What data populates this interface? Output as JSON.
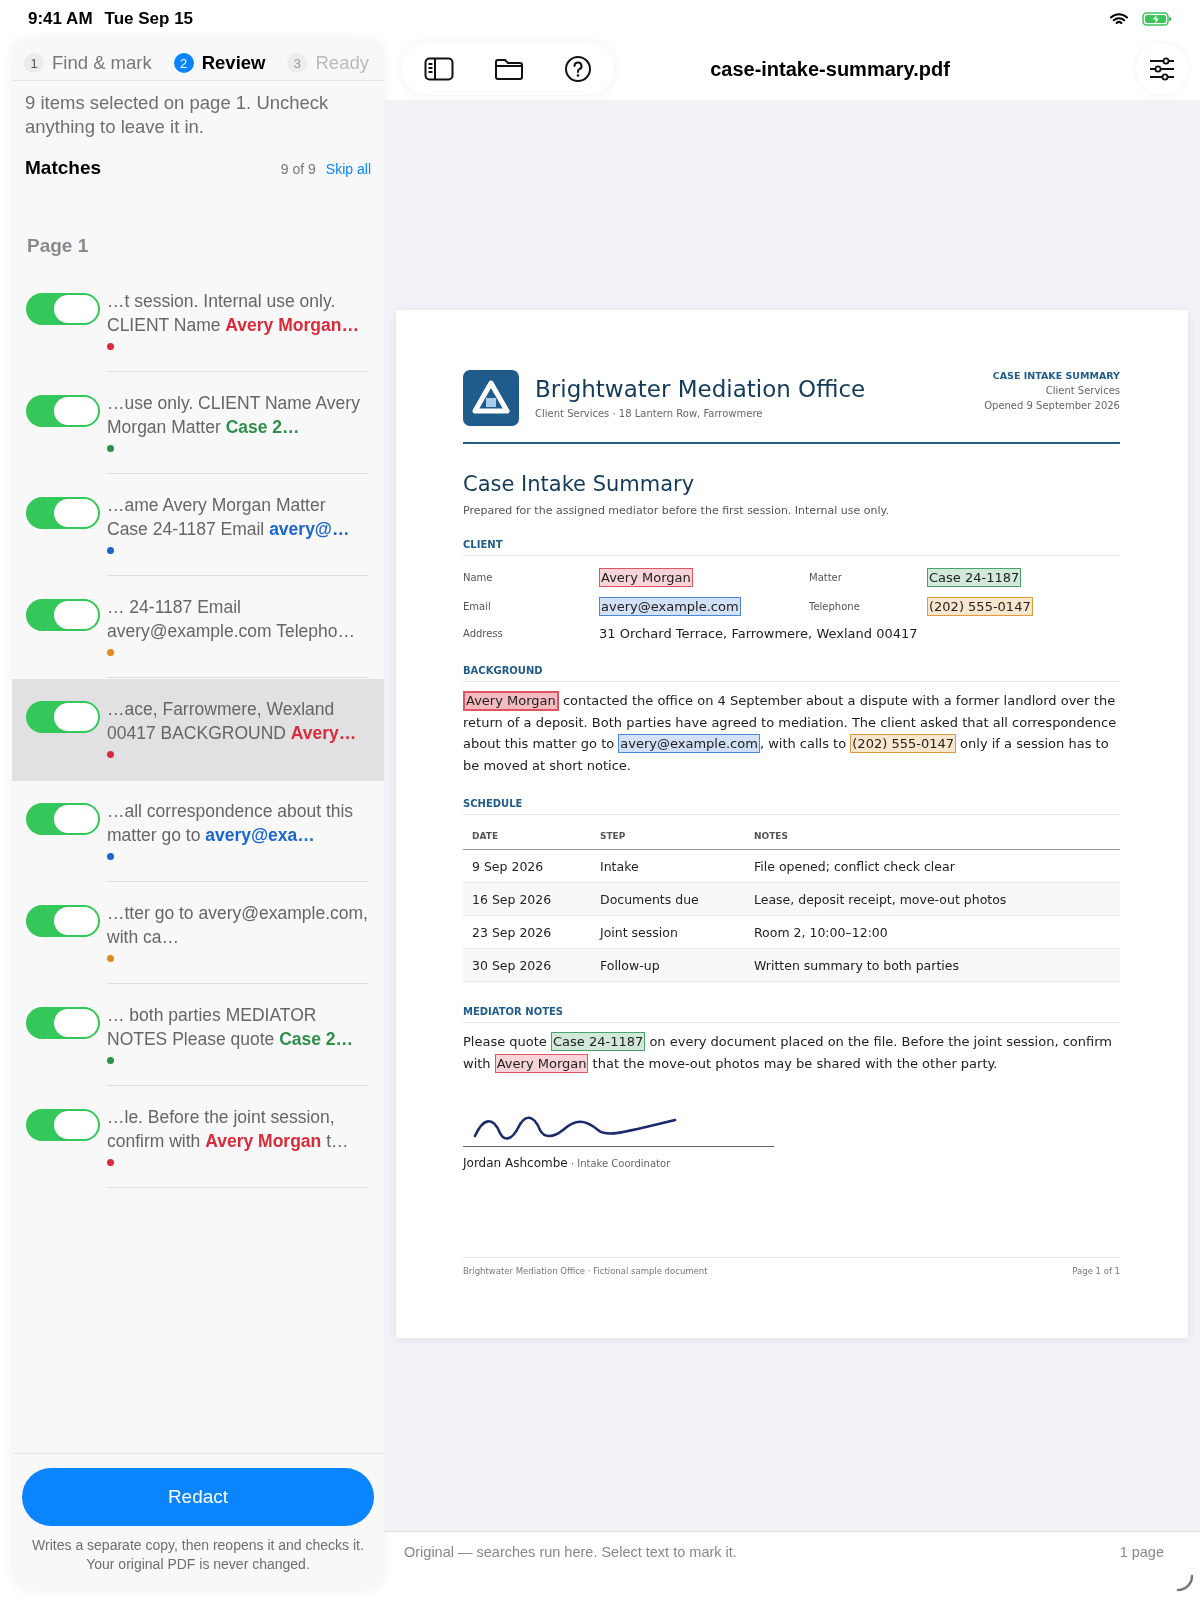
{
  "status_bar": {
    "time": "9:41 AM",
    "date": "Tue Sep 15"
  },
  "steps": [
    {
      "number": "1",
      "label": "Find & mark",
      "selected": false,
      "done": true
    },
    {
      "number": "2",
      "label": "Review",
      "selected": true,
      "done": false
    },
    {
      "number": "3",
      "label": "Ready",
      "selected": false,
      "done": false
    }
  ],
  "intro": "9 items selected on page 1. Uncheck anything to leave it in.",
  "matches": {
    "title": "Matches",
    "count": "9 of 9",
    "skip_link": "Skip all",
    "page_label": "Page 1",
    "items": [
      {
        "before": "…t session. Internal use only. CLIENT Name ",
        "hit": "Avery Morgan…",
        "color": "#d92b3a",
        "on": true,
        "selected": false
      },
      {
        "before": "…use only. CLIENT Name Avery Morgan Matter ",
        "hit": "Case 2…",
        "color": "#2e8f4a",
        "on": true,
        "selected": false
      },
      {
        "before": "…ame Avery Morgan Matter Case 24-1187 Email ",
        "hit": "avery@…",
        "color": "#1a66cc",
        "on": true,
        "selected": false
      },
      {
        "before": "… 24-1187 Email avery@example.com Telepho…",
        "color": "#e08a1a",
        "on": true,
        "selected": false
      },
      {
        "before": "…ace, Farrowmere, Wexland 00417 BACKGROUND ",
        "hit": "Avery…",
        "color": "#d92b3a",
        "on": true,
        "selected": true
      },
      {
        "before": "…all correspondence about this matter go to ",
        "hit": "avery@exa…",
        "color": "#1a66cc",
        "on": true,
        "selected": false
      },
      {
        "before": "…tter go to avery@example.com, with ca…",
        "color": "#e08a1a",
        "on": true,
        "selected": false
      },
      {
        "before": "… both parties MEDIATOR NOTES Please quote ",
        "hit": "Case 2…",
        "color": "#2e8f4a",
        "on": true,
        "selected": false
      },
      {
        "before": "…le. Before the joint session, confirm with ",
        "hit": "Avery Morgan",
        "after": " t…",
        "color": "#d92b3a",
        "on": true,
        "selected": false
      }
    ]
  },
  "redact": {
    "button": "Redact",
    "note": "Writes a separate copy, then reopens it and checks it. Your original PDF is never changed."
  },
  "toolbar": {
    "title": "case-intake-summary.pdf"
  },
  "document": {
    "org": "Brightwater Mediation Office",
    "org_sub": "Client Services · 18 Lantern Row, Farrowmere",
    "doc_label": "CASE INTAKE SUMMARY",
    "dept": "Client Services",
    "opened": "Opened 9 September 2026",
    "title": "Case Intake Summary",
    "subtitle": "Prepared for the assigned mediator before the first session. Internal use only.",
    "client_heading": "CLIENT",
    "fields": [
      {
        "label": "Name",
        "value": "Avery Morgan",
        "color": "#e05561"
      },
      {
        "label": "Matter",
        "value": "Case 24-1187",
        "color": "#4aa36a"
      },
      {
        "label": "Email",
        "value": "avery@example.com",
        "color": "#4a88d9"
      },
      {
        "label": "Telephone",
        "value": "(202) 555-0147",
        "color": "#e39a3c"
      },
      {
        "label": "Address",
        "value": "31 Orchard Terrace, Farrowmere, Wexland 00417"
      }
    ],
    "background_heading": "BACKGROUND",
    "background": [
      {
        "text": "Avery Morgan",
        "color": "#e05561",
        "current": true
      },
      {
        "text": " contacted the office on 4 September about a dispute with a former landlord over the return of a deposit. Both parties have agreed to mediation. The client asked that all correspondence about this matter go to "
      },
      {
        "text": "avery@example.com",
        "color": "#4a88d9",
        "current": false
      },
      {
        "text": ", with calls to "
      },
      {
        "text": "(202) 555-0147",
        "color": "#e39a3c",
        "current": false
      },
      {
        "text": " only if a session has to be moved at short notice."
      }
    ],
    "schedule_heading": "SCHEDULE",
    "schedule_columns": [
      "DATE",
      "STEP",
      "NOTES"
    ],
    "schedule_rows": [
      [
        "9 Sep 2026",
        "Intake",
        "File opened; conflict check clear"
      ],
      [
        "16 Sep 2026",
        "Documents due",
        "Lease, deposit receipt, move-out photos"
      ],
      [
        "23 Sep 2026",
        "Joint session",
        "Room 2, 10:00–12:00"
      ],
      [
        "30 Sep 2026",
        "Follow-up",
        "Written summary to both parties"
      ]
    ],
    "notes_heading": "MEDIATOR NOTES",
    "notes": [
      {
        "text": "Please quote "
      },
      {
        "text": "Case 24-1187",
        "color": "#4aa36a",
        "current": false
      },
      {
        "text": " on every document placed on the file. Before the joint session, confirm with "
      },
      {
        "text": "Avery Morgan",
        "color": "#e05561",
        "current": false
      },
      {
        "text": " that the move-out photos may be shared with the other party."
      }
    ],
    "signer": "Jordan Ashcombe",
    "signer_role": " · Intake Coordinator",
    "footer_left": "Brightwater Mediation Office · Fictional sample document",
    "footer_right": "Page 1 of 1"
  },
  "bottom_bar": {
    "hint": "Original — searches run here. Select text to mark it.",
    "pages": "1 page"
  }
}
